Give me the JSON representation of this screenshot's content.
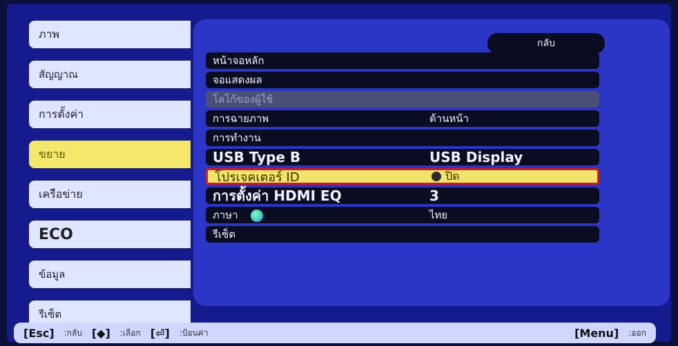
{
  "tabs": [
    {
      "label": "ภาพ"
    },
    {
      "label": "สัญญาณ"
    },
    {
      "label": "การตั้งค่า"
    },
    {
      "label": "ขยาย"
    },
    {
      "label": "เครือข่าย"
    },
    {
      "label": "ECO"
    },
    {
      "label": "ข้อมูล"
    },
    {
      "label": "รีเซ็ต"
    }
  ],
  "panel": {
    "back_label": "กลับ",
    "rows": [
      {
        "label": "หน้าจอหลัก",
        "value": ""
      },
      {
        "label": "จอแสดงผล",
        "value": ""
      },
      {
        "label": "โลโก้ของผู้ใช้",
        "value": ""
      },
      {
        "label": "การฉายภาพ",
        "value": "ด้านหน้า"
      },
      {
        "label": "การทำงาน",
        "value": ""
      },
      {
        "label": "USB Type B",
        "value": "USB Display"
      },
      {
        "label": "โปรเจคเตอร์ ID",
        "value": "ปิด"
      },
      {
        "label": "การตั้งค่า HDMI EQ",
        "value": "3"
      },
      {
        "label": "ภาษา",
        "value": "ไทย"
      },
      {
        "label": "รีเซ็ต",
        "value": ""
      }
    ]
  },
  "bottom": {
    "esc_key": "[Esc]",
    "esc_desc": ":กลับ",
    "select_key": "[◆]",
    "select_desc": ":เลือก",
    "enter_key": "[⏎]",
    "enter_desc": ":ป้อนค่า",
    "menu_key": "[Menu]",
    "menu_desc": ":ออก"
  },
  "colors": {
    "frame": "#151b8e",
    "panel": "#2b36c6",
    "tab": "#dfe6ff",
    "tab_active": "#f3e86b",
    "row_bg": "#0a0d22",
    "highlight_border": "#d11a1a"
  }
}
